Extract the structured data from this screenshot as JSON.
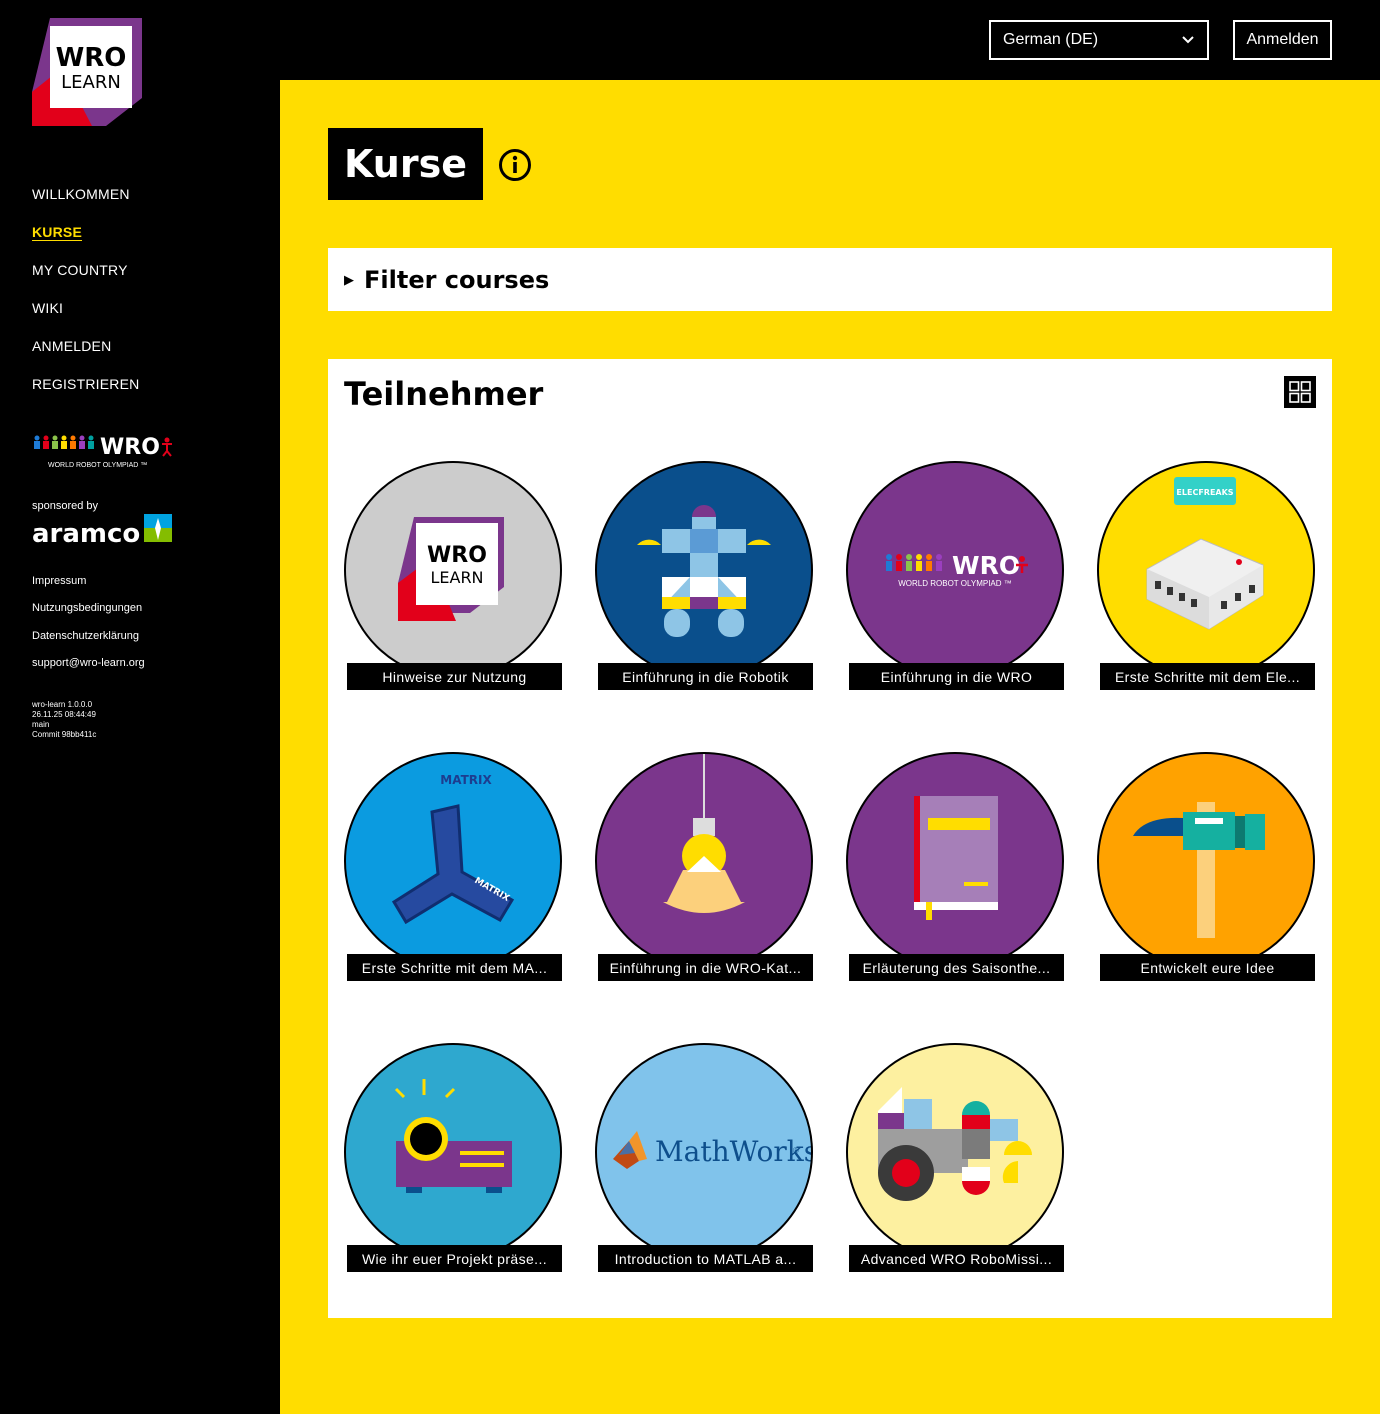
{
  "sidebar": {
    "logo_line1": "WRO",
    "logo_line2": "LEARN",
    "nav": [
      {
        "label": "WILLKOMMEN",
        "active": false
      },
      {
        "label": "KURSE",
        "active": true
      },
      {
        "label": "MY COUNTRY",
        "active": false
      },
      {
        "label": "WIKI",
        "active": false
      },
      {
        "label": "ANMELDEN",
        "active": false
      },
      {
        "label": "REGISTRIEREN",
        "active": false
      }
    ],
    "wro_logo": {
      "text": "WRO",
      "sub": "WORLD ROBOT OLYMPIAD ™"
    },
    "sponsored_by": "sponsored by",
    "sponsor_name": "aramco",
    "footer_links": [
      "Impressum",
      "Nutzungsbedingungen",
      "Datenschutzerklärung",
      "support@wro-learn.org"
    ],
    "version": [
      "wro-learn 1.0.0.0",
      "26.11.25 08:44:49",
      "main",
      "Commit 98bb411c"
    ]
  },
  "topbar": {
    "language": "German (DE)",
    "login_button": "Anmelden"
  },
  "main": {
    "page_title": "Kurse",
    "filter_label": "Filter courses",
    "section_title": "Teilnehmer",
    "courses": [
      {
        "caption": "Hinweise zur Nutzung",
        "bg": "#cccccc",
        "art": "wrolearn"
      },
      {
        "caption": "Einführung in die Robotik",
        "bg": "#0a4f8c",
        "art": "robot"
      },
      {
        "caption": "Einführung in die WRO",
        "bg": "#7b368c",
        "art": "wro"
      },
      {
        "caption": "Erste Schritte mit dem Ele...",
        "bg": "#ffdd00",
        "art": "elecfreaks"
      },
      {
        "caption": "Erste Schritte mit dem MA...",
        "bg": "#0b9be0",
        "art": "matrix"
      },
      {
        "caption": "Einführung in die WRO-Kat...",
        "bg": "#7b368c",
        "art": "bulb"
      },
      {
        "caption": "Erläuterung des Saisonthe...",
        "bg": "#7b368c",
        "art": "book"
      },
      {
        "caption": "Entwickelt eure Idee",
        "bg": "#ffa200",
        "art": "hammer"
      },
      {
        "caption": "Wie ihr euer Projekt präse...",
        "bg": "#2ea8cf",
        "art": "projector"
      },
      {
        "caption": "Introduction to MATLAB a...",
        "bg": "#80c3eb",
        "art": "mathworks"
      },
      {
        "caption": "Advanced WRO RoboMissi...",
        "bg": "#fdf0a0",
        "art": "tractor"
      }
    ],
    "art_text": {
      "wro_word": "WRO",
      "wro_sub": "WORLD ROBOT OLYMPIAD ™",
      "elecfreaks": "ELECFREAKS",
      "matrix": "MATRIX",
      "mathworks": "MathWorks"
    }
  },
  "colors": {
    "accent": "#ffdd00",
    "black": "#000000",
    "white": "#ffffff",
    "wro_red": "#e2001a",
    "wro_purple": "#7b368c"
  }
}
